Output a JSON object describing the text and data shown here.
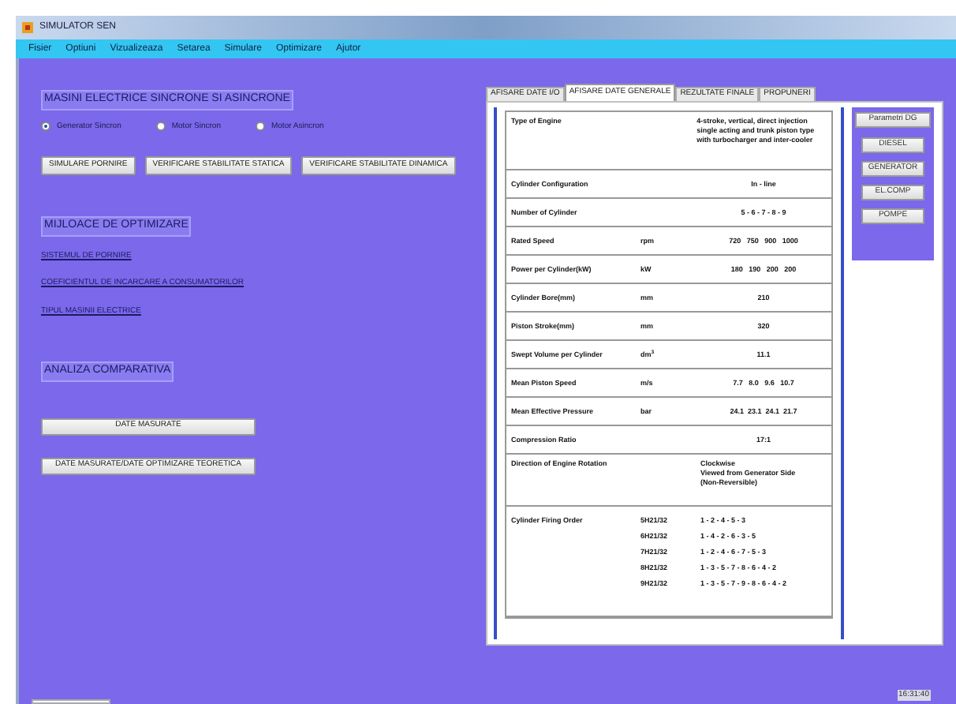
{
  "window": {
    "title": "SIMULATOR SEN"
  },
  "menu": [
    "Fisier",
    "Optiuni",
    "Vizualizeaza",
    "Setarea",
    "Simulare",
    "Optimizare",
    "Ajutor"
  ],
  "machines": {
    "heading": "MASINI ELECTRICE SINCRONE SI ASINCRONE",
    "radios": [
      {
        "label": "Generator Sincron",
        "selected": true
      },
      {
        "label": "Motor Sincron",
        "selected": false
      },
      {
        "label": "Motor Asincron",
        "selected": false
      }
    ],
    "buttons": [
      "SIMULARE PORNIRE",
      "VERIFICARE STABILITATE STATICA",
      "VERIFICARE STABILITATE DINAMICA"
    ]
  },
  "optimization": {
    "heading": "MIJLOACE DE OPTIMIZARE",
    "links": [
      "SISTEMUL DE PORNIRE",
      "COEFICIENTUL DE INCARCARE A CONSUMATORILOR",
      "TIPUL MASINII ELECTRICE"
    ]
  },
  "comparison": {
    "heading": "ANALIZA COMPARATIVA",
    "buttons": [
      "DATE MASURATE",
      "DATE MASURATE/DATE OPTIMIZARE TEORETICA"
    ]
  },
  "tabs": [
    {
      "label": "AFISARE DATE I/O",
      "selected": false
    },
    {
      "label": "AFISARE DATE GENERALE",
      "selected": true
    },
    {
      "label": "REZULTATE FINALE",
      "selected": false
    },
    {
      "label": "PROPUNERI",
      "selected": false
    }
  ],
  "table": {
    "rows": [
      {
        "kind": "text",
        "label": "Type of Engine",
        "value": "4-stroke, vertical, direct injection single acting and trunk piston type with turbocharger and inter-cooler"
      },
      {
        "kind": "single",
        "label": "Cylinder Configuration",
        "value": "In - line"
      },
      {
        "kind": "single",
        "label": "Number of Cylinder",
        "value": "5 - 6 - 7 - 8 - 9"
      },
      {
        "kind": "single",
        "label": "Rated Speed",
        "unit": "rpm",
        "value": "720   750   900   1000"
      },
      {
        "kind": "single",
        "label": "Power per Cylinder(kW)",
        "unit": "kW",
        "value": "180   190   200   200"
      },
      {
        "kind": "single",
        "label": "Cylinder Bore(mm)",
        "unit": "mm",
        "value": "210"
      },
      {
        "kind": "single",
        "label": "Piston Stroke(mm)",
        "unit": "mm",
        "value": "320"
      },
      {
        "kind": "single",
        "label": "Swept Volume per Cylinder",
        "unit": "dm$^{3}$",
        "value": "11.1"
      },
      {
        "kind": "single",
        "label": "Mean Piston Speed",
        "unit": "m/s",
        "value": "7.7   8.0   9.6   10.7"
      },
      {
        "kind": "single",
        "label": "Mean Effective Pressure",
        "unit": "bar",
        "value": "24.1  23.1  24.1  21.7"
      },
      {
        "kind": "single",
        "label": "Compression Ratio",
        "value": "17:1"
      },
      {
        "kind": "lines",
        "label": "Direction of Engine Rotation",
        "lines": [
          "Clockwise",
          "Viewed from Generator Side",
          "(Non-Reversible)"
        ]
      },
      {
        "kind": "firing",
        "label": "Cylinder Firing Order",
        "entries": [
          {
            "model": "5H21/32",
            "order": "1 - 2 - 4 - 5 - 3"
          },
          {
            "model": "6H21/32",
            "order": "1 - 4 - 2 - 6 - 3 - 5"
          },
          {
            "model": "7H21/32",
            "order": "1 - 2 - 4 - 6 - 7 - 5 - 3"
          },
          {
            "model": "8H21/32",
            "order": "1 - 3 - 5 - 7 - 8 - 6 - 4 - 2"
          },
          {
            "model": "9H21/32",
            "order": "1 - 3 - 5 - 7 - 9 - 8 - 6 - 4 - 2"
          }
        ]
      }
    ]
  },
  "side_buttons": [
    "Parametri DG",
    "DIESEL",
    "GENERATOR",
    "EL.COMP",
    "POMPE"
  ],
  "clock": "16:31:40"
}
